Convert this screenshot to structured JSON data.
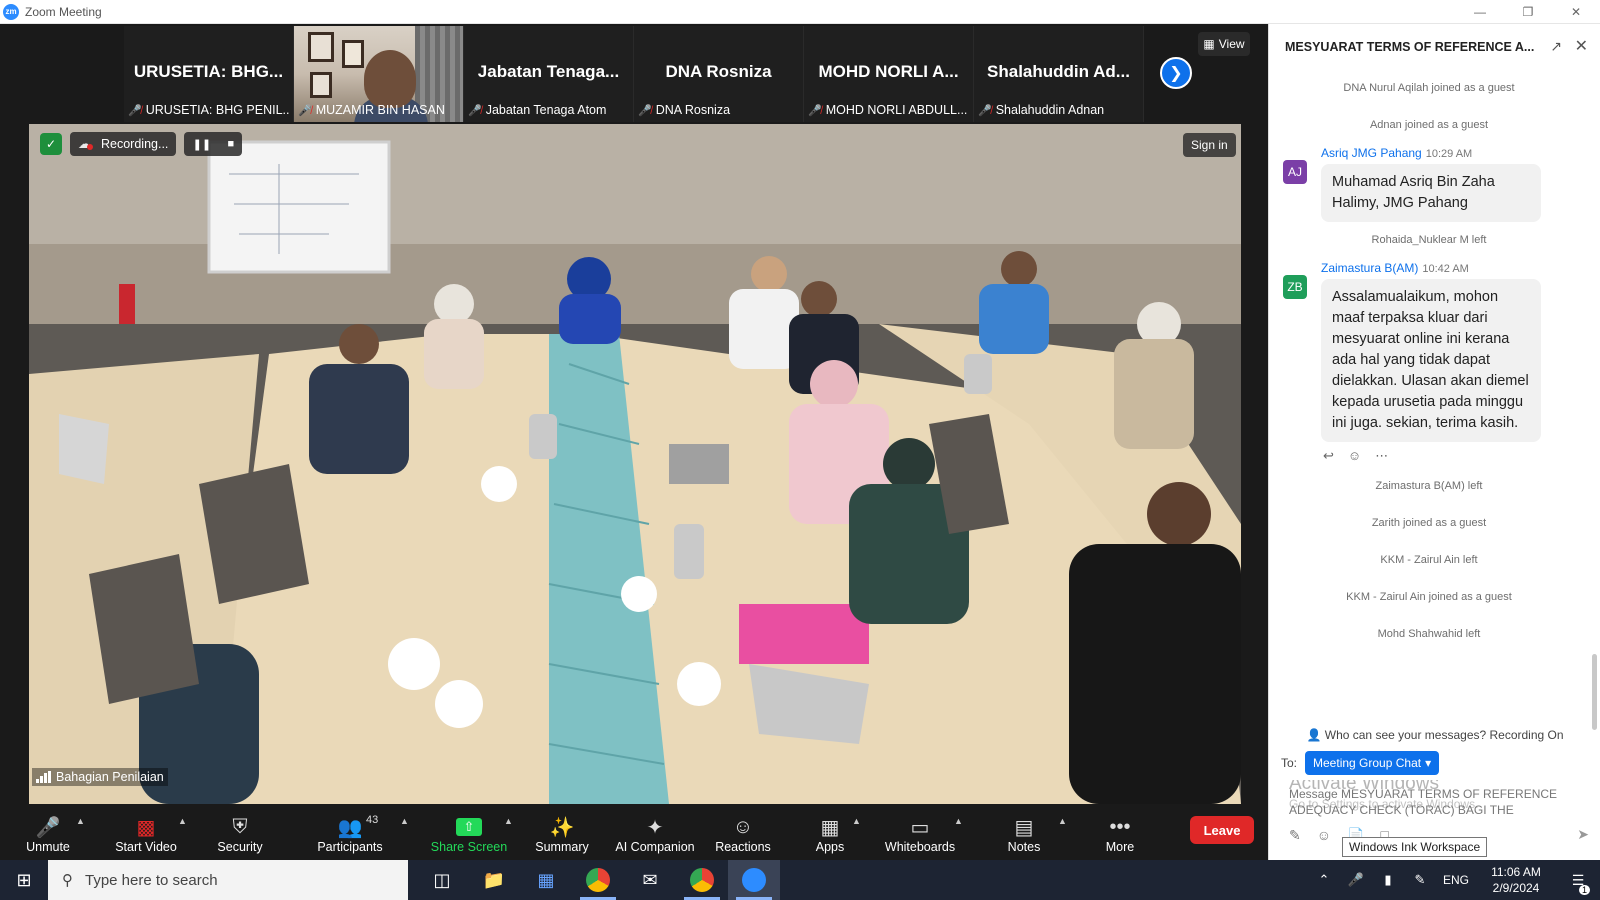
{
  "window": {
    "app_logo": "zm",
    "title": "Zoom Meeting"
  },
  "gallery": {
    "tiles": [
      {
        "name": "URUSETIA: BHG...",
        "label": "URUSETIA: BHG PENIL...",
        "type": "name"
      },
      {
        "name": "",
        "label": "MUZAMIR BIN HASAN",
        "type": "photo"
      },
      {
        "name": "Jabatan Tenaga...",
        "label": "Jabatan Tenaga Atom",
        "type": "name"
      },
      {
        "name": "DNA Rosniza",
        "label": "DNA Rosniza",
        "type": "name"
      },
      {
        "name": "MOHD NORLI A...",
        "label": "MOHD NORLI ABDULL...",
        "type": "name"
      },
      {
        "name": "Shalahuddin Ad...",
        "label": "Shalahuddin Adnan",
        "type": "name"
      }
    ],
    "view_label": "View",
    "next_icon": "chevron-right-icon"
  },
  "main_video": {
    "recording_label": "Recording...",
    "sign_in_label": "Sign in",
    "room_name": "Bahagian Penilaian"
  },
  "toolbar": {
    "unmute": "Unmute",
    "start_video": "Start Video",
    "security": "Security",
    "participants": "Participants",
    "participants_count": "43",
    "share_screen": "Share Screen",
    "summary": "Summary",
    "ai_companion": "AI Companion",
    "reactions": "Reactions",
    "apps": "Apps",
    "whiteboards": "Whiteboards",
    "notes": "Notes",
    "more": "More",
    "leave": "Leave"
  },
  "chat": {
    "title": "MESYUARAT TERMS OF REFERENCE A...",
    "sys1": "DNA Nurul Aqilah joined as a guest",
    "sys2": "Adnan joined as a guest",
    "msg1": {
      "avatar": "AJ",
      "avatar_color": "#7b3fa7",
      "sender": "Asriq JMG Pahang",
      "time": "10:29 AM",
      "text": "Muhamad Asriq Bin Zaha Halimy, JMG Pahang"
    },
    "sys3": "Rohaida_Nuklear M left",
    "msg2": {
      "avatar": "ZB",
      "avatar_color": "#1f9e5a",
      "sender": "Zaimastura B(AM)",
      "time": "10:42 AM",
      "text": "Assalamualaikum, mohon maaf terpaksa kluar dari mesyuarat online ini kerana ada hal yang tidak dapat dielakkan. Ulasan akan diemel kepada urusetia pada minggu ini juga. sekian, terima kasih."
    },
    "sys4": "Zaimastura B(AM) left",
    "sys5": "Zarith joined as a guest",
    "sys6": "KKM - Zairul Ain left",
    "sys7": "KKM - Zairul Ain joined as a guest",
    "sys8": "Mohd Shahwahid left",
    "visibility": "Who can see your messages? Recording On",
    "to_label": "To:",
    "recipient": "Meeting Group Chat",
    "input_placeholder": "Message MESYUARAT TERMS OF REFERENCE ADEQUACY CHECK (TORAC) BAGI THE PROPOSED...",
    "watermark_title": "Activate Windows",
    "watermark_sub": "Go to Settings to activate Windows.",
    "ink_tooltip": "Windows Ink Workspace"
  },
  "taskbar": {
    "search_placeholder": "Type here to search",
    "lang": "ENG",
    "time": "11:06 AM",
    "date": "2/9/2024",
    "notif_count": "1"
  },
  "colors": {
    "accent_blue": "#0e71eb",
    "leave_red": "#e02828",
    "share_green": "#23d959"
  }
}
